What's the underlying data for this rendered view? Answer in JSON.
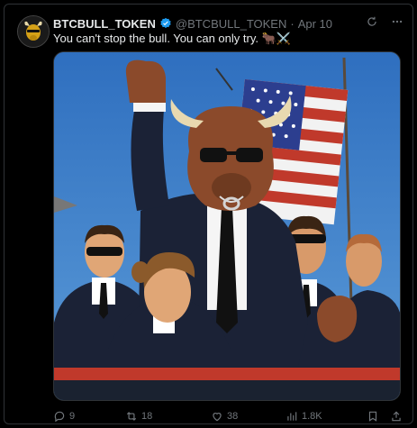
{
  "post": {
    "display_name": "BTCBULL_TOKEN",
    "handle": "@BTCBULL_TOKEN",
    "separator": "·",
    "date": "Apr 10",
    "text": "You can't stop the bull. You can only try. 🐂⚔️"
  },
  "actions": {
    "replies": "9",
    "reposts": "18",
    "likes": "38",
    "views": "1.8K"
  },
  "colors": {
    "background": "#000000",
    "text": "#e7e9ea",
    "muted": "#71767b",
    "verified": "#1d9bf0",
    "border": "#2f3336"
  },
  "icons": [
    "verified-badge-icon",
    "grok-icon",
    "more-icon",
    "reply-icon",
    "repost-icon",
    "like-icon",
    "views-icon",
    "bookmark-icon",
    "share-icon"
  ]
}
